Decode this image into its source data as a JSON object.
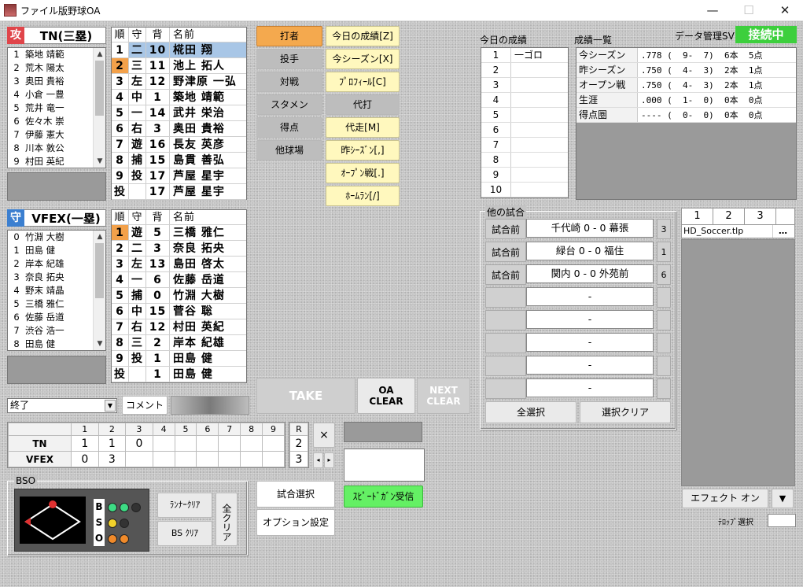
{
  "window": {
    "title": "ファイル版野球OA",
    "min": "—",
    "max": "☐",
    "close": "✕"
  },
  "offense": {
    "badge": "攻",
    "team": "TN(三塁)",
    "color": "#e0454a",
    "roster": [
      [
        "1",
        "築地 靖範"
      ],
      [
        "2",
        "荒木 陽太"
      ],
      [
        "3",
        "奥田 貴裕"
      ],
      [
        "4",
        "小倉 一豊"
      ],
      [
        "5",
        "荒井 竜一"
      ],
      [
        "6",
        "佐々木 崇"
      ],
      [
        "7",
        "伊藤 憲大"
      ],
      [
        "8",
        "川本 敦公"
      ],
      [
        "9",
        "村田 英紀"
      ]
    ]
  },
  "defense": {
    "badge": "守",
    "team": "VFEX(一塁)",
    "color": "#3b7fd0",
    "roster": [
      [
        "0",
        "竹淵 大樹"
      ],
      [
        "1",
        "田島 健"
      ],
      [
        "2",
        "岸本 紀雄"
      ],
      [
        "3",
        "奈良 拓央"
      ],
      [
        "4",
        "野末 靖晶"
      ],
      [
        "5",
        "三橋 雅仁"
      ],
      [
        "6",
        "佐藤 岳道"
      ],
      [
        "7",
        "渋谷 浩一"
      ],
      [
        "8",
        "田島 健"
      ]
    ]
  },
  "lineup_headers": [
    "順",
    "守",
    "背",
    "名前"
  ],
  "off_lineup": [
    [
      "1",
      "二",
      "10",
      "椛田 翔"
    ],
    [
      "2",
      "三",
      "11",
      "池上 拓人"
    ],
    [
      "3",
      "左",
      "12",
      "野津原 一弘"
    ],
    [
      "4",
      "中",
      "1",
      "築地 靖範"
    ],
    [
      "5",
      "一",
      "14",
      "武井 栄治"
    ],
    [
      "6",
      "右",
      "3",
      "奥田 貴裕"
    ],
    [
      "7",
      "遊",
      "16",
      "長友 英彦"
    ],
    [
      "8",
      "捕",
      "15",
      "島貫 善弘"
    ],
    [
      "9",
      "投",
      "17",
      "芦屋 星宇"
    ],
    [
      "投",
      "",
      "17",
      "芦屋 星宇"
    ]
  ],
  "def_lineup": [
    [
      "1",
      "遊",
      "5",
      "三橋 雅仁"
    ],
    [
      "2",
      "二",
      "3",
      "奈良 拓央"
    ],
    [
      "3",
      "左",
      "13",
      "島田 啓太"
    ],
    [
      "4",
      "一",
      "6",
      "佐藤 岳道"
    ],
    [
      "5",
      "捕",
      "0",
      "竹淵 大樹"
    ],
    [
      "6",
      "中",
      "15",
      "菅谷 聡"
    ],
    [
      "7",
      "右",
      "12",
      "村田 英紀"
    ],
    [
      "8",
      "三",
      "2",
      "岸本 紀雄"
    ],
    [
      "9",
      "投",
      "1",
      "田島 健"
    ],
    [
      "投",
      "",
      "1",
      "田島 健"
    ]
  ],
  "buttons": {
    "batter": "打者",
    "pitcher": "投手",
    "matchup": "対戦",
    "starting": "スタメン",
    "score": "得点",
    "other_park": "他球場",
    "today": "今日の成績[Z]",
    "this_season": "今シーズン[X]",
    "profile": "ﾌﾟﾛﾌｨｰﾙ[C]",
    "pinch_hit": "代打",
    "pinch_run": "代走[M]",
    "last_season": "昨ｼｰｽﾞﾝ[,]",
    "open": "ｵｰﾌﾟﾝ戦[.]",
    "homerun": "ﾎｰﾑﾗﾝ[/]",
    "take": "TAKE",
    "oa_clear_1": "OA",
    "oa_clear_2": "CLEAR",
    "next_clear_1": "NEXT",
    "next_clear_2": "CLEAR",
    "comment": "コメント",
    "runner_clear": "ﾗﾝﾅｰｸﾘｱ",
    "bs_clear": "BS ｸﾘｱ",
    "all_clear": "全クリア",
    "game_select": "試合選択",
    "option": "オプション設定",
    "speedgun": "ｽﾋﾟｰﾄﾞｶﾞﾝ受信",
    "select_all": "全選択",
    "select_clear": "選択クリア",
    "effect_on": "エフェクト オン",
    "x": "×"
  },
  "status_select": "終了",
  "scoreboard": {
    "innings": [
      "1",
      "2",
      "3",
      "4",
      "5",
      "6",
      "7",
      "8",
      "9"
    ],
    "r": "R",
    "teams": [
      {
        "name": "TN",
        "scores": [
          "1",
          "1",
          "0",
          "",
          "",
          "",
          "",
          "",
          ""
        ],
        "r": "2"
      },
      {
        "name": "VFEX",
        "scores": [
          "0",
          "3",
          "",
          "",
          "",
          "",
          "",
          "",
          ""
        ],
        "r": "3"
      }
    ]
  },
  "bso": {
    "title": "BSO",
    "b": "B",
    "s": "S",
    "o": "O",
    "balls": 2,
    "strikes": 1,
    "outs": 2
  },
  "today": {
    "title": "今日の成績",
    "rows": [
      [
        "1",
        "一ゴロ"
      ],
      [
        "2",
        ""
      ],
      [
        "3",
        ""
      ],
      [
        "4",
        ""
      ],
      [
        "5",
        ""
      ],
      [
        "6",
        ""
      ],
      [
        "7",
        ""
      ],
      [
        "8",
        ""
      ],
      [
        "9",
        ""
      ],
      [
        "10",
        ""
      ]
    ]
  },
  "stats": {
    "title": "成績一覧",
    "rows": [
      [
        "今シーズン",
        ".778 (  9-  7)  6本  5点"
      ],
      [
        "昨シーズン",
        ".750 (  4-  3)  2本  1点"
      ],
      [
        "オープン戦",
        ".750 (  4-  3)  2本  1点"
      ],
      [
        "生涯",
        ".000 (  1-  0)  0本  0点"
      ],
      [
        "得点圏",
        "---- (  0-  0)  0本  0点"
      ]
    ]
  },
  "datamgr": {
    "label": "データ管理SV",
    "status": "接続中"
  },
  "other_games": {
    "title": "他の試合",
    "rows": [
      [
        "試合前",
        "千代崎  0 - 0  幕張",
        "3"
      ],
      [
        "試合前",
        "緑台  0 - 0  福住",
        "1"
      ],
      [
        "試合前",
        "関内  0 - 0  外苑前",
        "6"
      ],
      [
        "",
        "-",
        ""
      ],
      [
        "",
        "-",
        ""
      ],
      [
        "",
        "-",
        ""
      ],
      [
        "",
        "-",
        ""
      ],
      [
        "",
        "-",
        ""
      ]
    ]
  },
  "tabs": [
    "1",
    "2",
    "3"
  ],
  "file": "HD_Soccer.tlp",
  "dots": "…",
  "telop": "ﾃﾛｯﾌﾟ選択"
}
